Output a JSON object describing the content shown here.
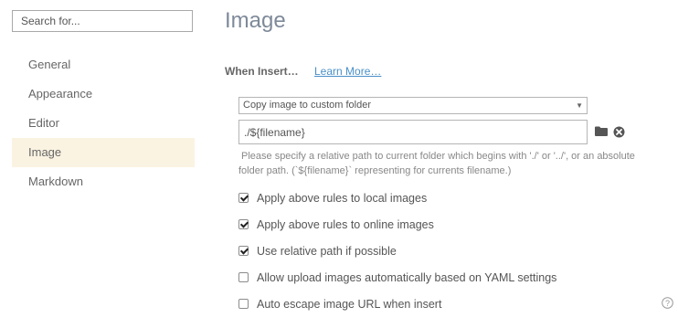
{
  "search": {
    "placeholder": "Search for..."
  },
  "sidebar": {
    "items": [
      {
        "label": "General"
      },
      {
        "label": "Appearance"
      },
      {
        "label": "Editor"
      },
      {
        "label": "Image",
        "active": true
      },
      {
        "label": "Markdown"
      }
    ]
  },
  "main": {
    "title": "Image",
    "when_insert_label": "When Insert…",
    "learn_more": "Learn More…",
    "insert_action": {
      "selected": "Copy image to custom folder"
    },
    "path_input": {
      "value": "./${filename}"
    },
    "help_text": "Please specify a relative path to current folder which begins with './' or '../', or an absolute folder path. (`${filename}` representing for currents filename.)",
    "options": [
      {
        "label": "Apply above rules to local images",
        "checked": true
      },
      {
        "label": "Apply above rules to online images",
        "checked": true
      },
      {
        "label": "Use relative path if possible",
        "checked": true
      },
      {
        "label": "Allow upload images automatically based on YAML settings",
        "checked": false
      },
      {
        "label": "Auto escape image URL when insert",
        "checked": false
      }
    ]
  },
  "icons": {
    "folder": "folder-icon",
    "clear": "clear-icon",
    "help": "help-icon",
    "caret": "chevron-down-icon"
  },
  "colors": {
    "title": "#7e8a99",
    "active_item_bg": "#fbf3e2",
    "link": "#4a90c7"
  }
}
